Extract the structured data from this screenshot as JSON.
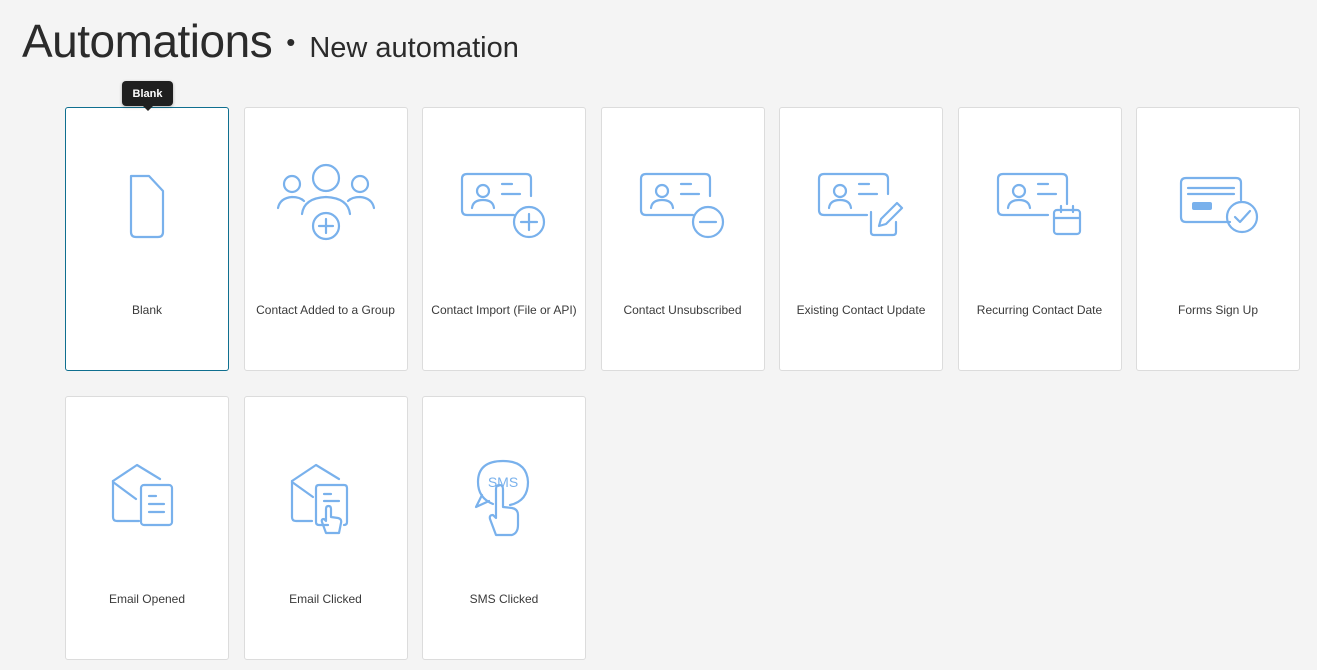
{
  "header": {
    "title": "Automations",
    "separator": "•",
    "subtitle": "New automation"
  },
  "tooltip": {
    "text": "Blank"
  },
  "colors": {
    "icon": "#79b1ec",
    "selected_border": "#0f6f8f",
    "background": "#f4f4f4"
  },
  "cards": [
    {
      "label": "Blank",
      "icon": "blank-document-icon",
      "selected": true
    },
    {
      "label": "Contact Added to a Group",
      "icon": "group-add-icon",
      "selected": false
    },
    {
      "label": "Contact Import (File or API)",
      "icon": "contact-card-add-icon",
      "selected": false
    },
    {
      "label": "Contact Unsubscribed",
      "icon": "contact-card-remove-icon",
      "selected": false
    },
    {
      "label": "Existing Contact Update",
      "icon": "contact-card-edit-icon",
      "selected": false
    },
    {
      "label": "Recurring Contact Date",
      "icon": "contact-card-calendar-icon",
      "selected": false
    },
    {
      "label": "Forms Sign Up",
      "icon": "form-check-icon",
      "selected": false
    },
    {
      "label": "Email Opened",
      "icon": "email-opened-icon",
      "selected": false
    },
    {
      "label": "Email Clicked",
      "icon": "email-clicked-icon",
      "selected": false
    },
    {
      "label": "SMS Clicked",
      "icon": "sms-clicked-icon",
      "selected": false,
      "icon_text": "SMS"
    }
  ]
}
